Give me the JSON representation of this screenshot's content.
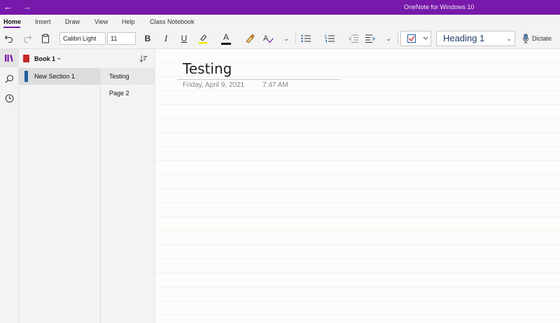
{
  "titlebar": {
    "back": "←",
    "forward": "→",
    "app_title": "OneNote for Windows 10"
  },
  "tabs": [
    {
      "label": "Home",
      "active": true
    },
    {
      "label": "Insert"
    },
    {
      "label": "Draw"
    },
    {
      "label": "View"
    },
    {
      "label": "Help"
    },
    {
      "label": "Class Notebook"
    }
  ],
  "toolbar": {
    "font_name": "Calibri Light",
    "font_size": "11",
    "bold": "B",
    "italic": "I",
    "underline": "U",
    "font_color_letter": "A",
    "style": "Heading 1",
    "dictate": "Dictate",
    "highlight_color": "#f7e600",
    "font_color": "#111111"
  },
  "notebook": {
    "name": "Book 1",
    "color": "#c62828",
    "sections": [
      {
        "label": "New Section 1",
        "color": "#1f5f9e"
      }
    ],
    "pages": [
      {
        "label": "Testing",
        "active": true
      },
      {
        "label": "Page 2"
      }
    ]
  },
  "page": {
    "title": "Testing",
    "date": "Friday, April 9, 2021",
    "time": "7:47 AM"
  },
  "colors": {
    "accent": "#7719aa"
  }
}
